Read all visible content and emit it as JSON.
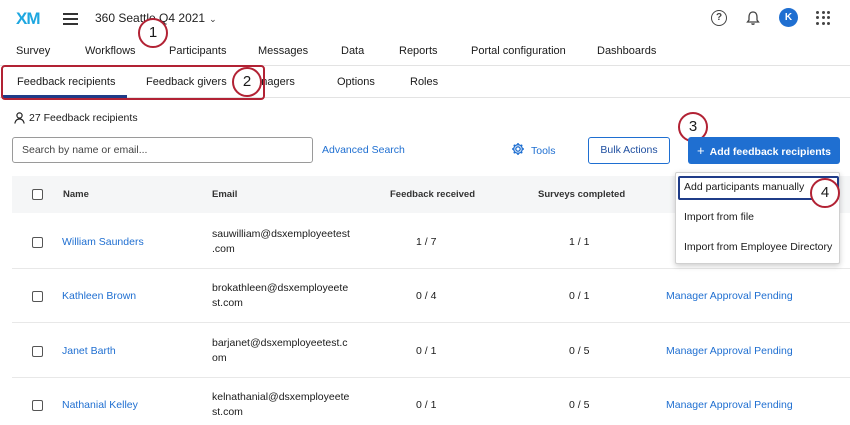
{
  "header": {
    "logo_x": "X",
    "logo_m": "M",
    "project_title": "360 Seattle Q4 2021",
    "avatar_initial": "K"
  },
  "main_nav": {
    "items": [
      "Survey",
      "Workflows",
      "Participants",
      "Messages",
      "Data",
      "Reports",
      "Portal configuration",
      "Dashboards"
    ]
  },
  "sub_nav": {
    "items": [
      "Feedback recipients",
      "Feedback givers",
      "Managers",
      "Options",
      "Roles"
    ],
    "active": "Feedback recipients"
  },
  "annotations": [
    "1",
    "2",
    "3",
    "4"
  ],
  "toolbar": {
    "count_label": "27 Feedback recipients",
    "search_placeholder": "Search by name or email...",
    "advanced_search": "Advanced Search",
    "tools": "Tools",
    "bulk_actions": "Bulk Actions",
    "add_button": "Add feedback recipients"
  },
  "dropdown": {
    "items": [
      "Add participants manually",
      "Import from file",
      "Import from Employee Directory"
    ]
  },
  "table": {
    "headers": [
      "Name",
      "Email",
      "Feedback received",
      "Surveys completed"
    ],
    "rows": [
      {
        "name": "William Saunders",
        "email": "sauwilliam@dsxemployeetest\n.com",
        "feedback": "1 / 7",
        "surveys": "1 / 1",
        "status": ""
      },
      {
        "name": "Kathleen Brown",
        "email": "brokathleen@dsxemployeete\nst.com",
        "feedback": "0 / 4",
        "surveys": "0 / 1",
        "status": "Manager Approval Pending"
      },
      {
        "name": "Janet Barth",
        "email": "barjanet@dsxemployeetest.c\nom",
        "feedback": "0 / 1",
        "surveys": "0 / 5",
        "status": "Manager Approval Pending"
      },
      {
        "name": "Nathanial Kelley",
        "email": "kelnathanial@dsxemployeete\nst.com",
        "feedback": "0 / 1",
        "surveys": "0 / 5",
        "status": "Manager Approval Pending"
      }
    ]
  },
  "colors": {
    "accent": "#1f6fd1",
    "annotation": "#b22234",
    "active_tab": "#1f3c88"
  }
}
